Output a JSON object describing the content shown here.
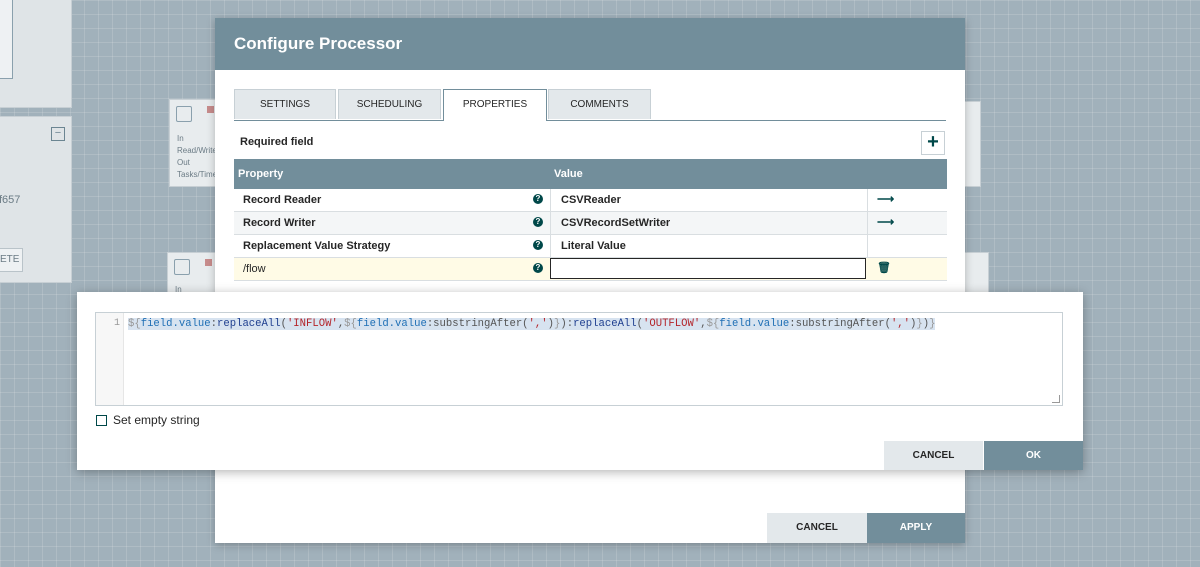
{
  "canvas": {
    "component_id_fragment": "f657",
    "delete_fragment": "ETE",
    "proc_labels": [
      "In",
      "Read/Write",
      "Out",
      "Tasks/Time"
    ],
    "proc2_label": "In"
  },
  "dialog": {
    "title": "Configure Processor",
    "tabs": [
      "SETTINGS",
      "SCHEDULING",
      "PROPERTIES",
      "COMMENTS"
    ],
    "active_tab": "PROPERTIES",
    "required_field_label": "Required field",
    "add_icon": "plus-icon",
    "table": {
      "headers": [
        "Property",
        "Value"
      ],
      "rows": [
        {
          "name": "Record Reader",
          "value": "CSVReader",
          "action": "go-to-arrow-icon"
        },
        {
          "name": "Record Writer",
          "value": "CSVRecordSetWriter",
          "action": "go-to-arrow-icon"
        },
        {
          "name": "Replacement Value Strategy",
          "value": "Literal Value",
          "action": ""
        },
        {
          "name": "/flow",
          "value": "",
          "action": "delete-icon"
        }
      ]
    },
    "cancel_label": "CANCEL",
    "apply_label": "APPLY"
  },
  "editor": {
    "line_number": "1",
    "code": "${field.value:replaceAll('INFLOW',${field.value:substringAfter(',')}):replaceAll('OUTFLOW',${field.value:substringAfter(',')})}",
    "set_empty_label": "Set empty string",
    "set_empty_checked": false,
    "cancel_label": "CANCEL",
    "ok_label": "OK"
  },
  "colors": {
    "header": "#728e9b",
    "accent": "#004849",
    "selected_row": "#fffbe6"
  }
}
